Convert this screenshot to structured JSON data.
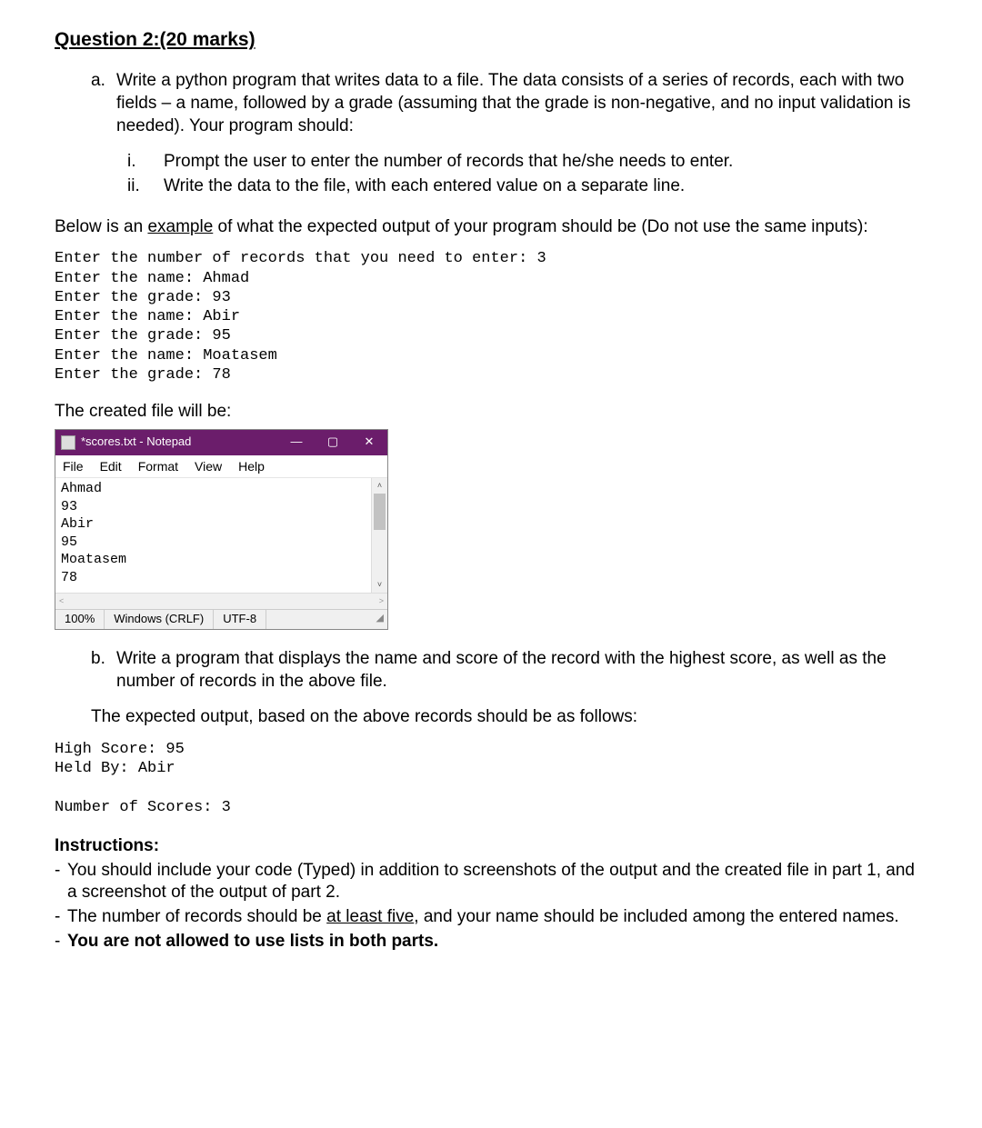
{
  "question_title": "Question 2:(20 marks)",
  "part_a": {
    "marker": "a.",
    "text": "Write a python program that writes data to a file. The  data consists of  a series of records, each with two fields – a name, followed by a grade (assuming that the grade is non-negative, and no input validation is needed). Your program should:"
  },
  "roman": [
    {
      "marker": "i.",
      "text": "Prompt the user to enter the number of records that he/she needs to enter."
    },
    {
      "marker": "ii.",
      "text": "Write the data to the file, with each entered value on a separate line."
    }
  ],
  "below_example_pre": "Below is an ",
  "below_example_underlined": "example",
  "below_example_post": " of what the expected output of your program should be (Do not use the same inputs):",
  "sample_io": "Enter the number of records that you need to enter: 3\nEnter the name: Ahmad\nEnter the grade: 93\nEnter the name: Abir\nEnter the grade: 95\nEnter the name: Moatasem\nEnter the grade: 78",
  "created_file_label": "The created file will be:",
  "notepad": {
    "title": "*scores.txt - Notepad",
    "menus": [
      "File",
      "Edit",
      "Format",
      "View",
      "Help"
    ],
    "content": "Ahmad\n93\nAbir\n95\nMoatasem\n78",
    "status_zoom": "100%",
    "status_eol": "Windows (CRLF)",
    "status_enc": "UTF-8"
  },
  "part_b": {
    "marker": "b.",
    "text": "Write a program that displays the name and score of the record with the highest score, as well as the number of records in the above file."
  },
  "expected_output_label": "The expected output, based on the above records should be as follows:",
  "sample_output_b": "High Score: 95\nHeld By: Abir\n\nNumber of Scores: 3",
  "instructions_title": "Instructions:",
  "instructions": [
    {
      "segments": [
        {
          "t": "You should include your code (Typed) in addition to screenshots of the output and the created file in part 1, and a screenshot of the output of part 2."
        }
      ]
    },
    {
      "segments": [
        {
          "t": "The number of records should be "
        },
        {
          "t": "at least five",
          "u": true
        },
        {
          "t": ", and your name should be included among the entered names."
        }
      ]
    },
    {
      "segments": [
        {
          "t": "You are not allowed to use lists in both parts.",
          "b": true
        }
      ]
    }
  ]
}
